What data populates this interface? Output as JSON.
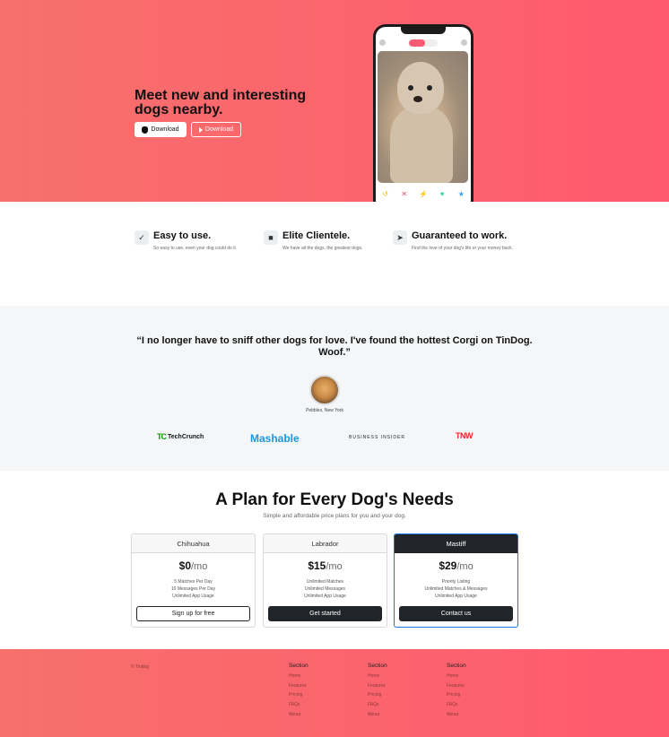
{
  "hero": {
    "title": "Meet new and interesting dogs nearby.",
    "download_apple": "Download",
    "download_play": "Download",
    "accent": "#ff5a6e"
  },
  "features": [
    {
      "icon": "check-circle-icon",
      "title": "Easy to use.",
      "text": "So easy to use, even your dog could do it."
    },
    {
      "icon": "graduation-cap-icon",
      "title": "Elite Clientele.",
      "text": "We have all the dogs, the greatest dogs."
    },
    {
      "icon": "heart-arrow-icon",
      "title": "Guaranteed to work.",
      "text": "Find the love of your dog's life or your money back."
    }
  ],
  "testimonial": {
    "quote": "“I no longer have to sniff other dogs for love. I've found the hottest Corgi on TinDog. Woof.”",
    "attribution": "Pebbles, New York"
  },
  "press": {
    "techcrunch": "TechCrunch",
    "mashable": "Mashable",
    "business_insider": "BUSINESS INSIDER",
    "tnw": "TNW"
  },
  "pricing": {
    "title": "A Plan for Every Dog's Needs",
    "subtitle": "Simple and affordable price plans for you and your dog.",
    "plans": [
      {
        "name": "Chihuahua",
        "price": "$0",
        "per": "/mo",
        "features": [
          "5 Matches Per Day",
          "10 Messages Per Day",
          "Unlimited App Usage"
        ],
        "button": "Sign up for free"
      },
      {
        "name": "Labrador",
        "price": "$15",
        "per": "/mo",
        "features": [
          "Unlimited Matches",
          "Unlimited Messages",
          "Unlimited App Usage"
        ],
        "button": "Get started"
      },
      {
        "name": "Mastiff",
        "price": "$29",
        "per": "/mo",
        "features": [
          "Priority Listing",
          "Unlimited Matches & Messages",
          "Unlimited App Usage"
        ],
        "button": "Contact us"
      }
    ]
  },
  "footer": {
    "copyright": "© Tindog",
    "columns": [
      {
        "heading": "Section",
        "links": [
          "Home",
          "Features",
          "Pricing",
          "FAQs",
          "About"
        ]
      },
      {
        "heading": "Section",
        "links": [
          "Home",
          "Features",
          "Pricing",
          "FAQs",
          "About"
        ]
      },
      {
        "heading": "Section",
        "links": [
          "Home",
          "Features",
          "Pricing",
          "FAQs",
          "About"
        ]
      }
    ]
  }
}
